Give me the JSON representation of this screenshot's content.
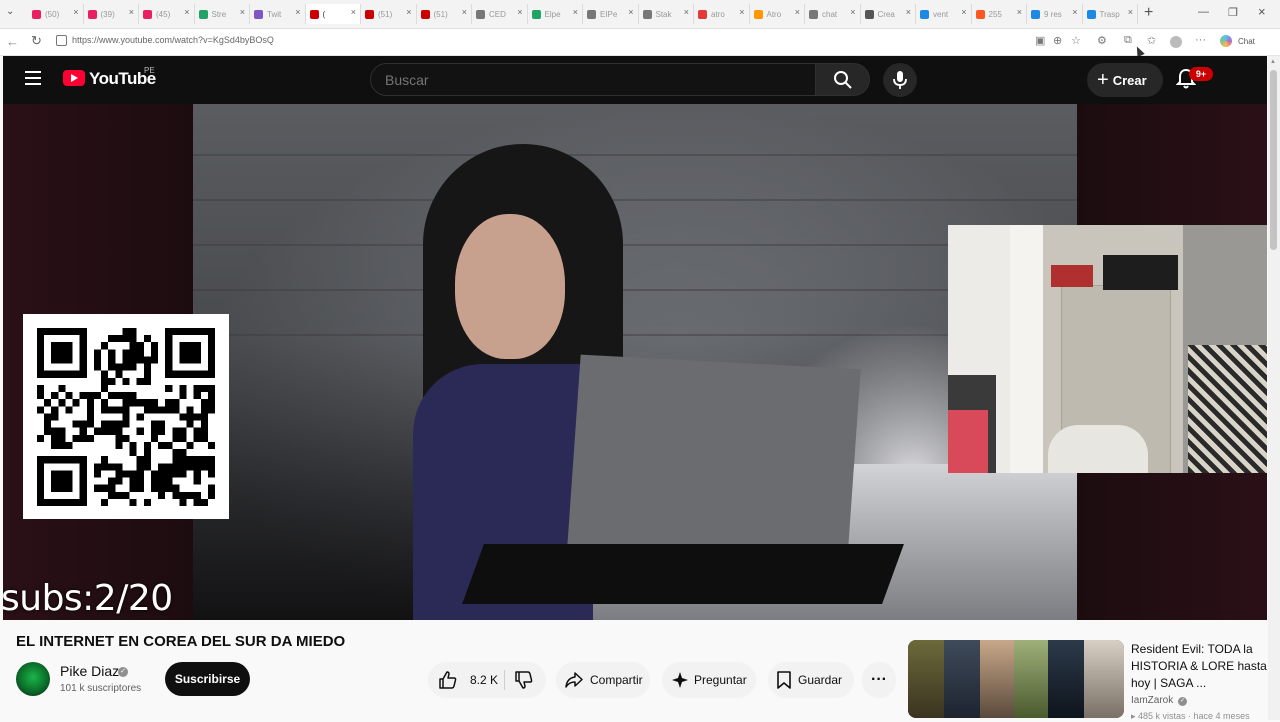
{
  "browser": {
    "tabs": [
      {
        "label": "(50)",
        "color": "#e91e63"
      },
      {
        "label": "(39)",
        "color": "#e91e63"
      },
      {
        "label": "(45)",
        "color": "#e91e63"
      },
      {
        "label": "Stre",
        "color": "#21a366"
      },
      {
        "label": "Twit",
        "color": "#7e57c2"
      },
      {
        "label": "(",
        "color": "#cc0000",
        "active": true
      },
      {
        "label": "(51)",
        "color": "#cc0000"
      },
      {
        "label": "(51)",
        "color": "#cc0000"
      },
      {
        "label": "CED",
        "color": "#777777"
      },
      {
        "label": "Elpe",
        "color": "#21a366"
      },
      {
        "label": "EIPe",
        "color": "#777777"
      },
      {
        "label": "Stak",
        "color": "#777777"
      },
      {
        "label": "atro",
        "color": "#e53935"
      },
      {
        "label": "Atro",
        "color": "#ff9800"
      },
      {
        "label": "chat",
        "color": "#777777"
      },
      {
        "label": "Crea",
        "color": "#555555"
      },
      {
        "label": "vent",
        "color": "#1e88e5"
      },
      {
        "label": "255",
        "color": "#ff5722"
      },
      {
        "label": "9 res",
        "color": "#1e88e5"
      },
      {
        "label": "Trasp",
        "color": "#1e88e5"
      }
    ],
    "url": "https://www.youtube.com/watch?v=KgSd4byBOsQ",
    "chat_label": "Chat",
    "icons": {
      "close": "×",
      "new_tab": "+",
      "minimize": "—",
      "maximize": "❐",
      "window_close": "×",
      "back": "←",
      "refresh": "↻",
      "menu": "⌄",
      "more": "···"
    }
  },
  "youtube": {
    "brand": "YouTube",
    "country": "PE",
    "search_placeholder": "Buscar",
    "create_label": "Crear",
    "notifications_badge": "9+"
  },
  "video": {
    "subs_overlay": "subs:2/20",
    "title": "EL INTERNET EN COREA DEL SUR DA MIEDO"
  },
  "channel": {
    "name": "Pike Diaz",
    "subscribers": "101 k suscriptores",
    "subscribe_label": "Suscribirse"
  },
  "actions": {
    "likes": "8.2 K",
    "share": "Compartir",
    "ask": "Preguntar",
    "save": "Guardar",
    "more": "···"
  },
  "recommendation": {
    "title": "Resident Evil: TODA la HISTORIA & LORE hasta hoy | SAGA ...",
    "channel": "IamZarok",
    "meta": "▸ 485 k vistas · hace 4 meses"
  },
  "colors": {
    "youtube_red": "#ff0033",
    "masthead": "#0f0f0f",
    "badge": "#cc0000"
  }
}
